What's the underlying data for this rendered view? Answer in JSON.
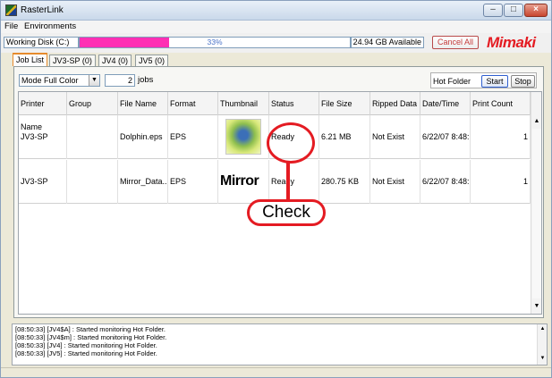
{
  "window": {
    "title": "RasterLink"
  },
  "menu": {
    "items": [
      {
        "label": "File",
        "underline": "F"
      },
      {
        "label": "Environments",
        "underline": "v"
      }
    ]
  },
  "disk": {
    "label": "Working Disk (C:)",
    "usage_percent": 33,
    "usage_text": "33%",
    "available": "24.94 GB Available",
    "fill_color": "#ff2fb4"
  },
  "toolbar": {
    "cancel_all": "Cancel All"
  },
  "brand": {
    "logo_text": "MIMAKI",
    "color": "#e41b22"
  },
  "tabs": [
    {
      "label": "Job List",
      "active": true
    },
    {
      "label": "JV3-SP (0)",
      "active": false
    },
    {
      "label": "JV4 (0)",
      "active": false
    },
    {
      "label": "JV5 (0)",
      "active": false
    }
  ],
  "mode": {
    "selected": "Mode Full Color",
    "job_count": "2",
    "jobs_label": "jobs"
  },
  "hot_folder": {
    "label": "Hot Folder",
    "start": "Start",
    "stop": "Stop"
  },
  "table": {
    "columns": [
      "Printer Name",
      "Group",
      "File Name",
      "Format",
      "Thumbnail",
      "Status",
      "File Size",
      "Ripped Data",
      "Date/Time",
      "Print Count"
    ],
    "rows": [
      {
        "printer": "JV3-SP",
        "group": "",
        "file": "Dolphin.eps",
        "format": "EPS",
        "thumbnail": "dolphin-image",
        "status": "Ready",
        "size": "6.21 MB",
        "ripped": "Not Exist",
        "datetime": "6/22/07 8:48:...",
        "count": "1"
      },
      {
        "printer": "JV3-SP",
        "group": "",
        "file": "Mirror_Data...",
        "format": "EPS",
        "thumbnail": "Mirror",
        "status": "Ready",
        "size": "280.75 KB",
        "ripped": "Not Exist",
        "datetime": "6/22/07 8:48:...",
        "count": "1"
      }
    ]
  },
  "callout": {
    "label": "Check",
    "color": "#e41b22"
  },
  "log": {
    "lines": [
      "[08:50:33] [JV4$A] : Started monitoring Hot Folder.",
      "[08:50:33] [JV4$m] : Started monitoring Hot Folder.",
      "[08:50:33] [JV4] : Started monitoring Hot Folder.",
      "[08:50:33] [JV5] : Started monitoring Hot Folder."
    ]
  },
  "icons": {
    "window_minimize": "minimize-icon",
    "window_maximize": "maximize-icon",
    "window_close": "close-icon",
    "dropdown": "chevron-down-icon",
    "scroll_up": "arrow-up-icon",
    "scroll_down": "arrow-down-icon"
  }
}
